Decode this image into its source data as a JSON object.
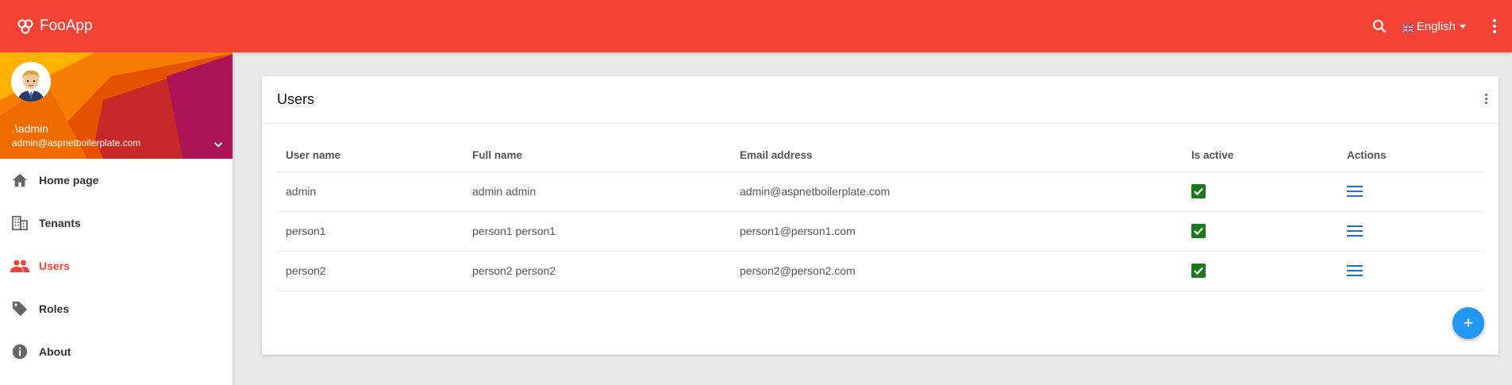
{
  "app": {
    "title": "FooApp",
    "brand_color": "#f44336"
  },
  "topbar": {
    "search_icon": "search-icon",
    "language": "English",
    "more_icon": "more-vert-icon"
  },
  "sidebar": {
    "user": {
      "name": ".\\admin",
      "email": "admin@aspnetboilerplate.com"
    },
    "items": [
      {
        "label": "Home page",
        "icon": "home-icon",
        "active": false
      },
      {
        "label": "Tenants",
        "icon": "building-icon",
        "active": false
      },
      {
        "label": "Users",
        "icon": "people-icon",
        "active": true
      },
      {
        "label": "Roles",
        "icon": "tag-icon",
        "active": false
      },
      {
        "label": "About",
        "icon": "info-icon",
        "active": false
      }
    ]
  },
  "main": {
    "title": "Users",
    "columns": [
      "User name",
      "Full name",
      "Email address",
      "Is active",
      "Actions"
    ],
    "rows": [
      {
        "username": "admin",
        "fullname": "admin admin",
        "email": "admin@aspnetboilerplate.com",
        "active": true
      },
      {
        "username": "person1",
        "fullname": "person1 person1",
        "email": "person1@person1.com",
        "active": true
      },
      {
        "username": "person2",
        "fullname": "person2 person2",
        "email": "person2@person2.com",
        "active": true
      }
    ],
    "add_button": "+"
  },
  "colors": {
    "active_check": "#1b7a1b",
    "actions_icon": "#1e6fc8",
    "fab": "#2196f3"
  }
}
